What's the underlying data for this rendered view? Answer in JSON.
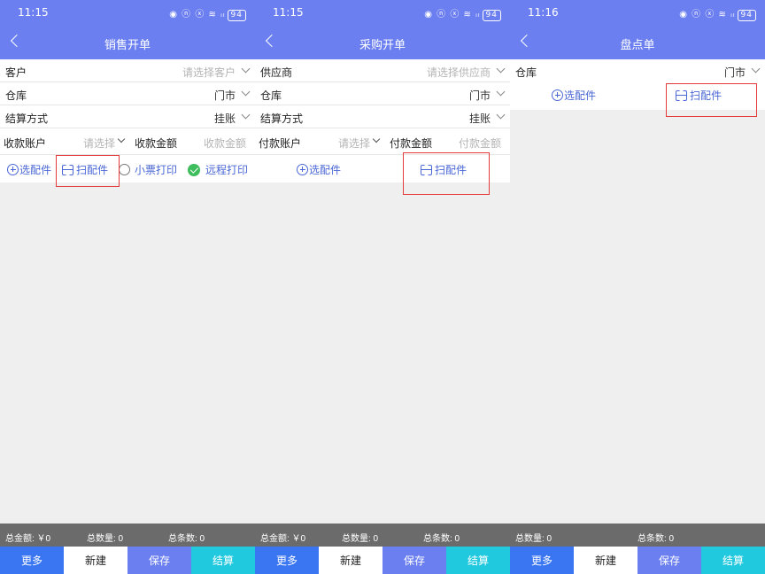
{
  "status": {
    "icons": "◉ ⓝ ⓧ ≋ ᵢₗ",
    "battery": "94"
  },
  "screens": [
    {
      "time": "11:15",
      "title": "销售开单",
      "fields": [
        {
          "label": "客户",
          "value": "请选择客户"
        },
        {
          "label": "仓库",
          "value": "门市"
        },
        {
          "label": "结算方式",
          "value": "挂账"
        }
      ],
      "account_label": "收款账户",
      "account_placeholder": "请选择",
      "amount_label": "收款金额",
      "amount_placeholder": "收款金额",
      "select_parts": "选配件",
      "scan_parts": "扫配件",
      "ticket_print": "小票打印",
      "remote_print": "远程打印",
      "summary": {
        "amount": "总金额: ￥0",
        "qty": "总数量: 0",
        "count": "总条数: 0"
      },
      "buttons": {
        "more": "更多",
        "new": "新建",
        "save": "保存",
        "settle": "结算"
      }
    },
    {
      "time": "11:15",
      "title": "采购开单",
      "fields": [
        {
          "label": "供应商",
          "value": "请选择供应商"
        },
        {
          "label": "仓库",
          "value": "门市"
        },
        {
          "label": "结算方式",
          "value": "挂账"
        }
      ],
      "account_label": "付款账户",
      "account_placeholder": "请选择",
      "amount_label": "付款金额",
      "amount_placeholder": "付款金额",
      "select_parts": "选配件",
      "scan_parts": "扫配件",
      "summary": {
        "amount": "总金额: ￥0",
        "qty": "总数量: 0",
        "count": "总条数: 0"
      },
      "buttons": {
        "more": "更多",
        "new": "新建",
        "save": "保存",
        "settle": "结算"
      }
    },
    {
      "time": "11:16",
      "title": "盘点单",
      "fields": [
        {
          "label": "仓库",
          "value": "门市"
        }
      ],
      "select_parts": "选配件",
      "scan_parts": "扫配件",
      "summary": {
        "qty": "总数量: 0",
        "count": "总条数: 0"
      },
      "buttons": {
        "more": "更多",
        "new": "新建",
        "save": "保存",
        "settle": "结算"
      }
    }
  ],
  "colors": {
    "header": "#6c7ff0",
    "more": "#3a75f2",
    "settle": "#21c9df",
    "link": "#4a67d6",
    "highlight": "#e23b3b"
  }
}
